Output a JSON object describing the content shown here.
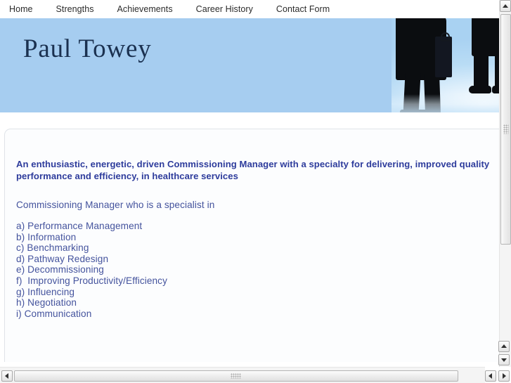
{
  "nav": {
    "items": [
      {
        "label": "Home"
      },
      {
        "label": "Strengths"
      },
      {
        "label": "Achievements"
      },
      {
        "label": "Career History"
      },
      {
        "label": "Contact Form"
      }
    ]
  },
  "banner": {
    "title": "Paul Towey",
    "background_color": "#a6cdf0",
    "title_color": "#1b3150",
    "photo_alt": "silhouettes of business people standing, lower bodies visible"
  },
  "content": {
    "lead_paragraph": "An enthusiastic, energetic, driven Commissioning Manager with a specialty for delivering, improved quality performance and efficiency, in healthcare services",
    "lead_color": "#2e3c9c",
    "sub_heading": "Commissioning Manager who is a specialist in",
    "body_color": "#44539d",
    "specialties": [
      "a) Performance Management",
      "b) Information",
      "c) Benchmarking",
      "d) Pathway Redesign",
      "e) Decommissioning",
      "f)  Improving Productivity/Efficiency",
      "g) Influencing",
      "h) Negotiation",
      "i) Communication"
    ]
  },
  "scrollbars": {
    "vertical": {
      "up_arrow_icon": "triangle-up-icon",
      "down_arrow_icon": "triangle-down-icon"
    },
    "horizontal": {
      "left_arrow_icon": "triangle-left-icon",
      "right_arrow_icon": "triangle-right-icon"
    }
  }
}
